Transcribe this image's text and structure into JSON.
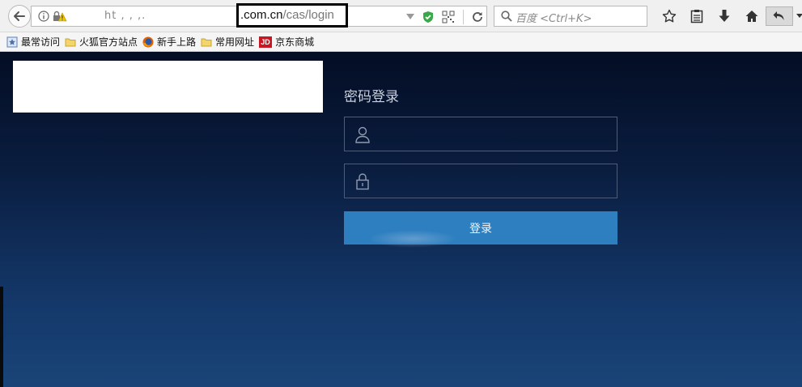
{
  "browser": {
    "url_prefix": "ht ,    ,  ,.",
    "url_domain": ".com.cn",
    "url_path": "/cas/login",
    "search_placeholder": "百度 <Ctrl+K>"
  },
  "bookmarks": [
    {
      "label": "最常访问",
      "icon": "bookmark-star-icon"
    },
    {
      "label": "火狐官方站点",
      "icon": "folder-icon"
    },
    {
      "label": "新手上路",
      "icon": "firefox-icon"
    },
    {
      "label": "常用网址",
      "icon": "folder-icon"
    },
    {
      "label": "京东商城",
      "icon": "jd-logo-icon",
      "logo_text": "JD"
    }
  ],
  "login": {
    "title": "密码登录",
    "username_placeholder": "",
    "password_placeholder": "",
    "submit_label": "登录"
  },
  "colors": {
    "page_top": "#040d24",
    "page_bottom": "#1a4477",
    "button": "#2e7fbf",
    "field_border": "#4d5d79"
  }
}
